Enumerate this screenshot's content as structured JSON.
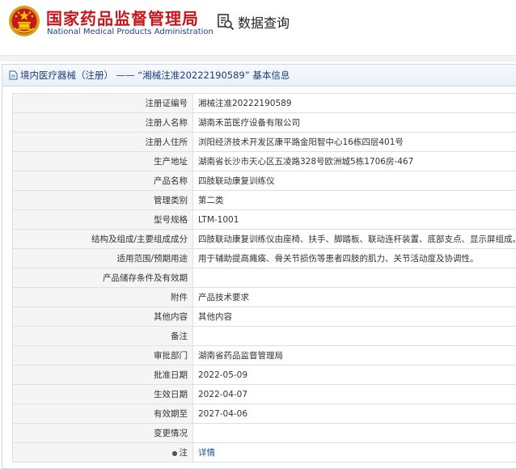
{
  "header": {
    "brand_cn": "国家药品监督管理局",
    "brand_en": "National Medical Products Administration",
    "query_label": "数据查询",
    "emblem_icon": "national-emblem-icon",
    "query_icon": "search-document-icon",
    "brand_color": "#c8161d"
  },
  "panel": {
    "title": "境内医疗器械（注册） —— “湘械注准20222190589” 基本信息",
    "rows": [
      {
        "label": "注册证编号",
        "value": "湘械注准20222190589"
      },
      {
        "label": "注册人名称",
        "value": "湖南禾茁医疗设备有限公司"
      },
      {
        "label": "注册人住所",
        "value": "浏阳经济技术开发区康平路金阳智中心16栋四层401号"
      },
      {
        "label": "生产地址",
        "value": "湖南省长沙市天心区五凌路328号欧洲城5栋1706房-467"
      },
      {
        "label": "产品名称",
        "value": "四肢联动康复训练仪"
      },
      {
        "label": "管理类别",
        "value": "第二类"
      },
      {
        "label": "型号规格",
        "value": "LTM-1001"
      },
      {
        "label": "结构及组成/主要组成成分",
        "value": "四肢联动康复训练仪由座椅、扶手、脚踏板、联动连杆装置、底部支点、显示屏组成。"
      },
      {
        "label": "适用范围/预期用途",
        "value": "用于辅助提高瘫痪、骨关节损伤等患者四肢的肌力、关节活动度及协调性。"
      },
      {
        "label": "产品储存条件及有效期",
        "value": ""
      },
      {
        "label": "附件",
        "value": "产品技术要求"
      },
      {
        "label": "其他内容",
        "value": "其他内容"
      },
      {
        "label": "备注",
        "value": ""
      },
      {
        "label": "审批部门",
        "value": "湖南省药品监督管理局"
      },
      {
        "label": "批准日期",
        "value": "2022-05-09"
      },
      {
        "label": "生效日期",
        "value": "2022-04-07"
      },
      {
        "label": "有效期至",
        "value": "2027-04-06"
      },
      {
        "label": "变更情况",
        "value": ""
      },
      {
        "label": "注",
        "value": "详情",
        "link": true
      }
    ]
  }
}
